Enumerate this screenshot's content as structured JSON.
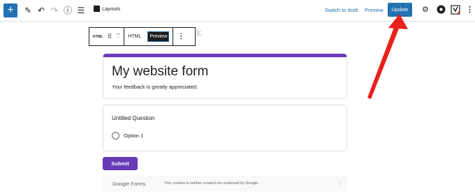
{
  "toolbar": {
    "add_icon": "plus-icon",
    "layouts_label": "Layouts",
    "switch_to_draft": "Switch to draft",
    "preview": "Preview",
    "update": "Update",
    "accent_color": "#2271b1"
  },
  "block_toolbar": {
    "block_type": "HTML",
    "tab_html": "HTML",
    "tab_preview": "Preview"
  },
  "ghost_text": "k",
  "form": {
    "title": "My website form",
    "description": "Your feedback is greatly appreciated.",
    "question": "Untitled Question",
    "option": "Option 1",
    "submit_label": "Submit",
    "accent_color": "#673ab7"
  },
  "footer": {
    "logo": "Google Forms",
    "note": "This content is neither created nor endorsed by Google."
  },
  "annotation": {
    "arrow_color": "#e8211c"
  }
}
